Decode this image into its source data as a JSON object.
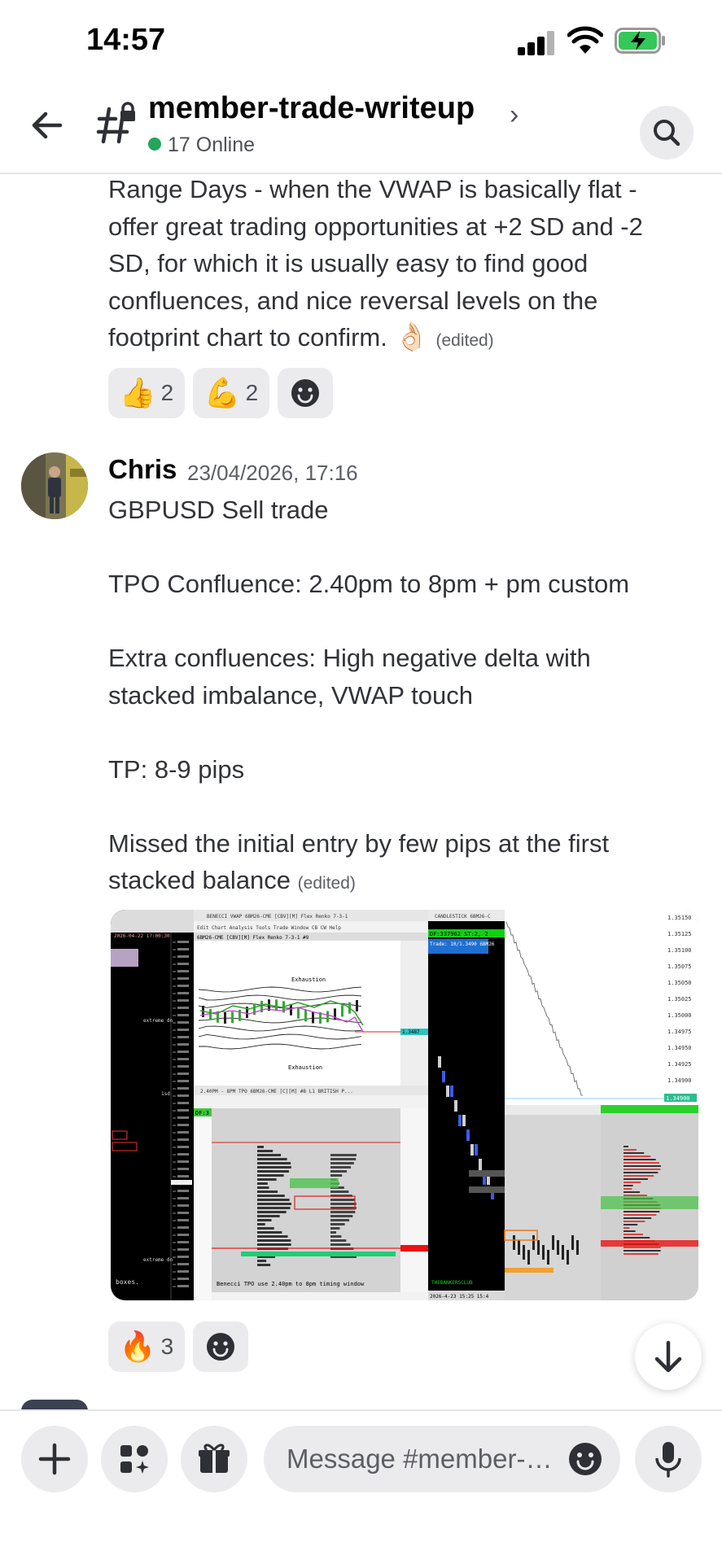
{
  "status_bar": {
    "time": "14:57"
  },
  "header": {
    "channel_name": "member-trade-writeup",
    "online": "17 Online"
  },
  "previous_message": {
    "lines": [
      "Range Days - when the VWAP is basically flat -",
      "offer great trading opportunities at +2 SD and -2",
      "SD, for which it is usually easy to find good",
      "confluences, and nice reversal levels on the",
      "footprint chart to confirm."
    ],
    "emoji": "👌🏻",
    "edited": "(edited)",
    "reactions": [
      {
        "emoji": "👍",
        "count": "2"
      },
      {
        "emoji": "💪",
        "count": "2"
      }
    ]
  },
  "message": {
    "author": "Chris",
    "timestamp": "23/04/2026, 17:16",
    "lines": [
      "GBPUSD Sell trade",
      "",
      "TPO Confluence: 2.40pm to 8pm + pm custom",
      "",
      "Extra confluences: High negative delta with",
      "stacked imbalance, VWAP touch",
      "",
      "TP: 8-9 pips",
      "",
      "Missed the initial entry by few pips at the first",
      "stacked balance"
    ],
    "edited": "(edited)",
    "reactions": [
      {
        "emoji": "🔥",
        "count": "3"
      }
    ],
    "attachment_texts": {
      "p1_date": "2026-04-22 17:00:30",
      "p1_label1": "extreme dn",
      "p1_label2": "1sd",
      "p1_label3": "extreme dn",
      "p1_label4": "boxes.",
      "p2_title": "BENECCI VWAP 6BM26-CME [CBV][M] Flex Renko 7-3-1",
      "p2_menu": "Edit  Chart  Analysis  Tools  Trade  Window  CB  CW  Help",
      "p2_inst": "6BM26-CME [CBV][M] Flex Renko 7-3-1 #9",
      "p2_exhaust_top": "Exhaustion",
      "p2_exhaust_bot": "Exhaustion",
      "p2_price": "1.3487",
      "p3_title": "2.40PM - 8PM TPO 6BM26-CME [C][M] #8 L1 BRITISH P...",
      "p3_caption": "Benecci TPO use 2.40pm to 8pm timing window",
      "p3_df": "DF:3",
      "p4_title": "CANDLESTICK 6BM26-C",
      "p4_df": "DF:337962  ST:2, 2",
      "p4_trade": "Trade: 10/1.3490  6BM26",
      "p4_footer": "THEBANKERSCLUB",
      "p4_date": "2026-4-23  15:25  15:4",
      "p5_prices": [
        "1.35150",
        "1.35125",
        "1.35100",
        "1.35075",
        "1.35050",
        "1.35025",
        "1.35000",
        "1.34975",
        "1.34950",
        "1.34925",
        "1.34900"
      ],
      "p5_last": "1.34900"
    }
  },
  "composer": {
    "placeholder": "Message #member-trade-writeup"
  },
  "colors": {
    "online": "#23a55a",
    "text": "#313338",
    "muted": "#5c5e66",
    "chip": "#ebebed"
  }
}
